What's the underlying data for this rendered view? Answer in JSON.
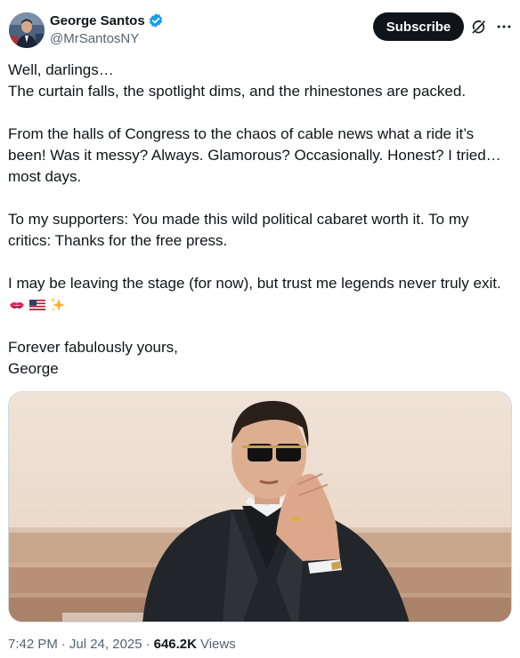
{
  "author": {
    "display_name": "George Santos",
    "handle": "@MrSantosNY",
    "verified": true,
    "verified_color": "#1d9bf0"
  },
  "actions": {
    "subscribe_label": "Subscribe",
    "grok_icon": "grok-icon",
    "more_icon": "more-icon"
  },
  "post": {
    "p1_line1": "Well, darlings…",
    "p1_line2": "The curtain falls, the spotlight dims, and the rhinestones are packed.",
    "p2": "From the halls of Congress to the chaos of cable news what a ride it’s been! Was it messy? Always. Glamorous? Occasionally. Honest? I tried… most days.",
    "p3": "To my supporters: You made this wild political cabaret worth it. To my critics: Thanks for the free press.",
    "p4": "I may be leaving the stage (for now), but trust me legends never truly exit.",
    "emojis": [
      "kiss-mark-emoji",
      "us-flag-emoji",
      "sparkles-emoji"
    ],
    "p5_line1": "Forever fabulously yours,",
    "p5_line2": "George"
  },
  "meta": {
    "time": "7:42 PM",
    "date": "Jul 24, 2025",
    "views_count": "646.2K",
    "views_label": "Views"
  },
  "colors": {
    "text_primary": "#0f1419",
    "text_secondary": "#536471",
    "button_bg": "#0f1419"
  }
}
